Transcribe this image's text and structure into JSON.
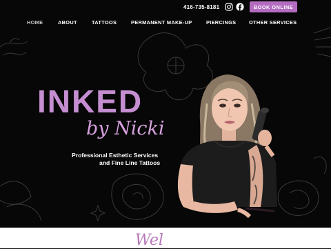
{
  "topbar": {
    "phone": "416-735-8181",
    "social": [
      {
        "icon": "instagram-icon"
      },
      {
        "icon": "facebook-icon"
      }
    ],
    "book_label": "BOOK ONLINE"
  },
  "nav": {
    "items": [
      {
        "label": "HOME",
        "active": true
      },
      {
        "label": "ABOUT"
      },
      {
        "label": "TATTOOS"
      },
      {
        "label": "PERMANENT MAKE-UP"
      },
      {
        "label": "PIERCINGS"
      },
      {
        "label": "OTHER SERVICES"
      }
    ]
  },
  "hero": {
    "brand_main": "INKED",
    "brand_sub": "by Nicki",
    "tagline_line1": "Professional Esthetic Services",
    "tagline_line2": "and Fine Line Tattoos"
  },
  "next_section": {
    "script_heading_partial": "Wel"
  },
  "colors": {
    "accent": "#b36cc0",
    "brand_text": "#c58ed1",
    "background": "#070707"
  }
}
